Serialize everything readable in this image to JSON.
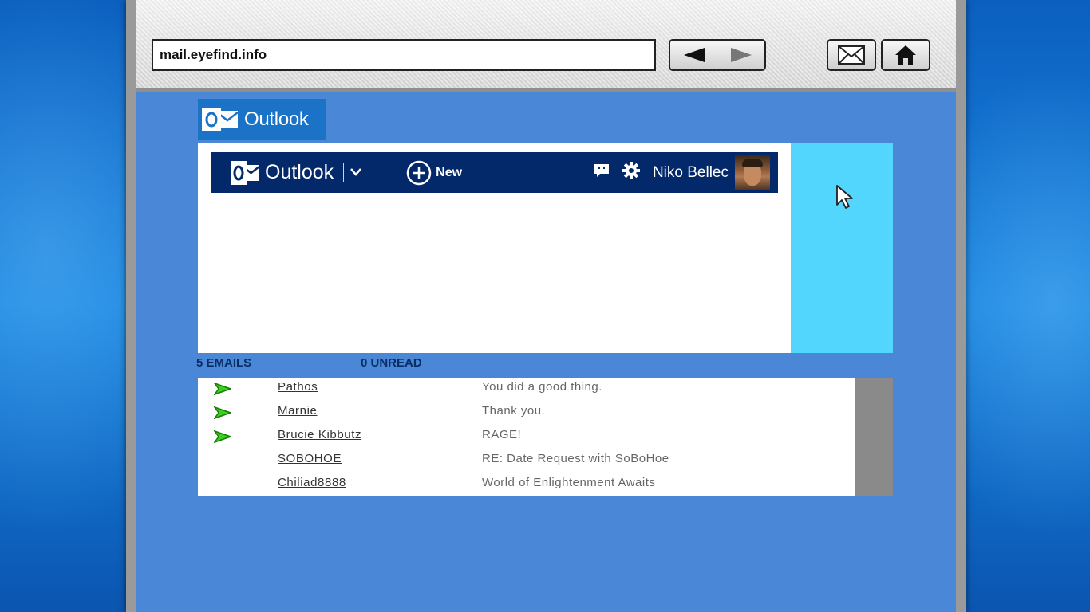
{
  "browser": {
    "url": "mail.eyefind.info",
    "back_icon": "arrow-left-icon",
    "forward_icon": "arrow-right-icon",
    "mail_icon": "envelope-icon",
    "home_icon": "home-icon"
  },
  "site": {
    "logo_text": "Outlook",
    "accent_color": "#1b73c8",
    "header_color": "#04296a",
    "side_color": "#52d6fd"
  },
  "outlook_header": {
    "brand": "Outlook",
    "new_label": "New",
    "user_name": "Niko Bellec"
  },
  "counts": {
    "emails": "5 EMAILS",
    "unread": "0 UNREAD"
  },
  "emails": [
    {
      "sender": "Pathos",
      "subject": "You did a good thing.",
      "flagged": true
    },
    {
      "sender": "Marnie",
      "subject": "Thank you.",
      "flagged": true
    },
    {
      "sender": "Brucie Kibbutz",
      "subject": "RAGE!",
      "flagged": true
    },
    {
      "sender": "SOBOHOE",
      "subject": "RE: Date Request with SoBoHoe",
      "flagged": false
    },
    {
      "sender": "Chiliad8888",
      "subject": "World of Enlightenment Awaits",
      "flagged": false
    }
  ]
}
